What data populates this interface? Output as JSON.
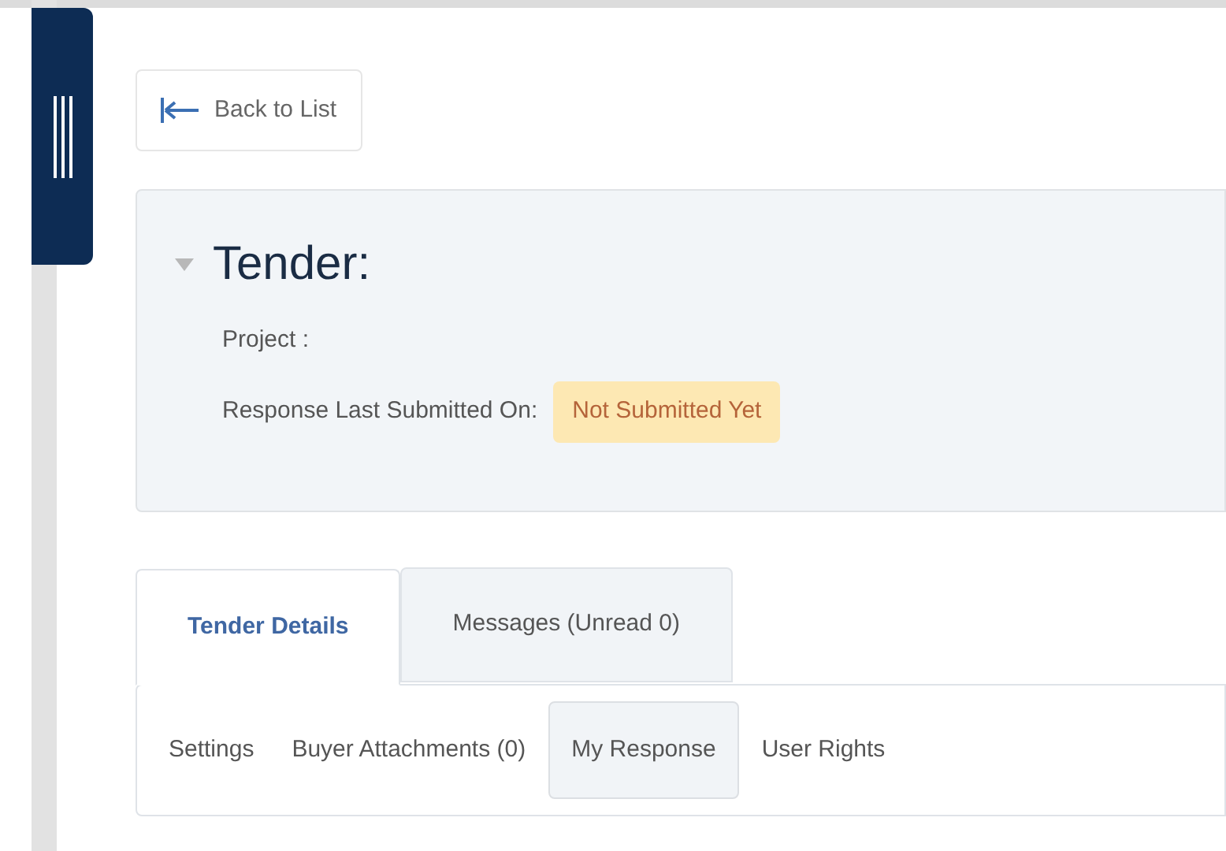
{
  "back_button": {
    "label": "Back to List"
  },
  "header": {
    "expanded": true,
    "title": "Tender:",
    "project_label": "Project :",
    "submitted_label": "Response Last Submitted On:",
    "submitted_status": "Not Submitted Yet"
  },
  "tabs": [
    {
      "label": "Tender Details",
      "selected": true
    },
    {
      "label": "Messages (Unread 0)",
      "selected": false
    }
  ],
  "subtabs": [
    {
      "label": "Settings",
      "selected": false
    },
    {
      "label": "Buyer Attachments (0)",
      "selected": false
    },
    {
      "label": "My Response",
      "selected": true
    },
    {
      "label": "User Rights",
      "selected": false
    }
  ]
}
